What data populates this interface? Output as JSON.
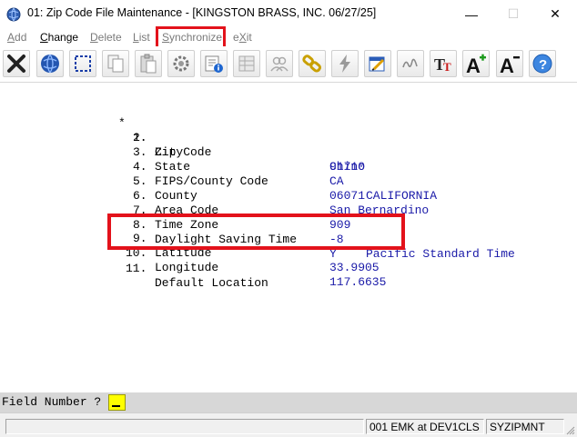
{
  "window": {
    "title": "01: Zip Code File Maintenance - [KINGSTON BRASS, INC. 06/27/25]",
    "minimize": "—",
    "maximize": "☐",
    "close": "✕"
  },
  "menu": [
    {
      "pre": "",
      "ul": "A",
      "post": "dd",
      "disabled": true
    },
    {
      "pre": "",
      "ul": "C",
      "post": "hange",
      "disabled": false
    },
    {
      "pre": "",
      "ul": "D",
      "post": "elete",
      "disabled": true
    },
    {
      "pre": "",
      "ul": "L",
      "post": "ist",
      "disabled": true
    },
    {
      "pre": "",
      "ul": "S",
      "post": "ynchronize",
      "disabled": true
    },
    {
      "pre": "e",
      "ul": "X",
      "post": "it",
      "disabled": true
    }
  ],
  "toolbar": {
    "icons": [
      "close-x-icon",
      "globe-icon",
      "select-box-icon",
      "copy-icon",
      "paste-icon",
      "settings-gear-icon",
      "document-info-icon",
      "grid-list-icon",
      "users-icon",
      "chain-link-icon",
      "lightning-icon",
      "calendar-edit-icon",
      "signature-icon",
      "font-style-icon",
      "font-increase-icon",
      "font-decrease-icon",
      "help-icon"
    ]
  },
  "fields": [
    {
      "marker": "*",
      "num": "1.",
      "label": "Zip Code",
      "value": "91710",
      "extra": ""
    },
    {
      "marker": "",
      "num": "2.",
      "label": "City",
      "value": "Chino",
      "extra": ""
    },
    {
      "marker": "",
      "num": "3.",
      "label": "State",
      "value": "CA",
      "extra": "CALIFORNIA"
    },
    {
      "marker": "",
      "num": "4.",
      "label": "FIPS/County Code",
      "value": "06071",
      "extra": ""
    },
    {
      "marker": "",
      "num": "5.",
      "label": "County",
      "value": "San Bernardino",
      "extra": ""
    },
    {
      "marker": "",
      "num": "6.",
      "label": "Area Code",
      "value": "909",
      "extra": ""
    },
    {
      "marker": "",
      "num": "7.",
      "label": "Time Zone",
      "value": "-8",
      "extra": "Pacific Standard Time"
    },
    {
      "marker": "",
      "num": "8.",
      "label": "Daylight Saving Time",
      "value": "Y",
      "extra": ""
    },
    {
      "marker": "",
      "num": "9.",
      "label": "Latitude",
      "value": "33.9905",
      "extra": ""
    },
    {
      "marker": "",
      "num": "10.",
      "label": "Longitude",
      "value": "117.6635",
      "extra": ""
    },
    {
      "marker": "",
      "num": "11.",
      "label": "Default Location",
      "value": "",
      "extra": ""
    }
  ],
  "prompt": {
    "label": "Field Number ?"
  },
  "status": {
    "panel1": "",
    "panel2": "001 EMK at DEV1CLS",
    "panel3": "SYZIPMNT"
  },
  "colors": {
    "highlight": "#e3121b",
    "value_text": "#1a1aa8",
    "prompt_input": "#ffff00"
  }
}
